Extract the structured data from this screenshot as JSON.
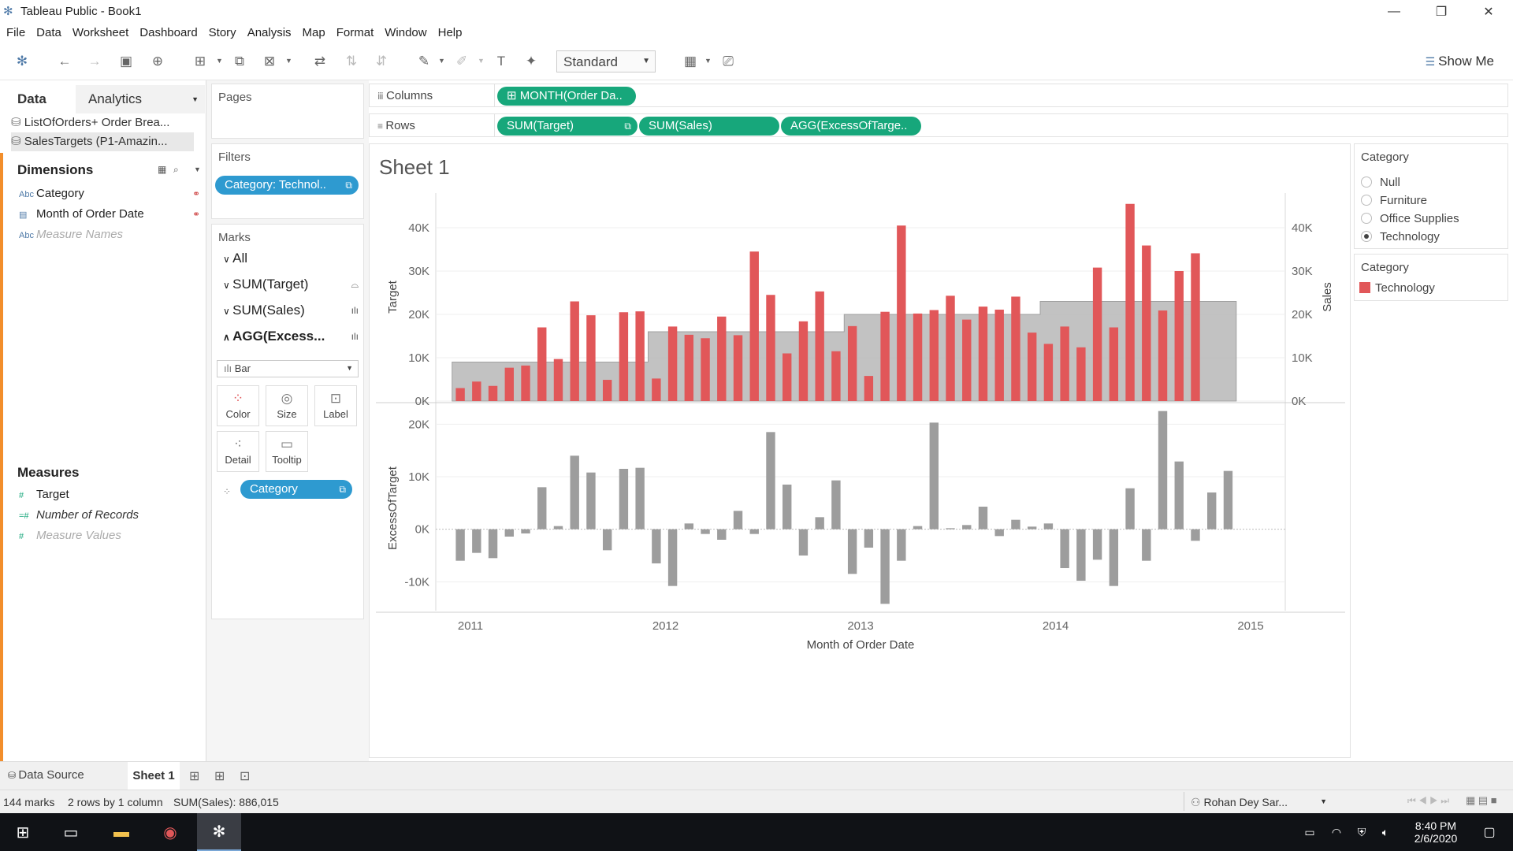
{
  "app": {
    "title": "Tableau Public - Book1"
  },
  "menu": [
    "File",
    "Data",
    "Worksheet",
    "Dashboard",
    "Story",
    "Analysis",
    "Map",
    "Format",
    "Window",
    "Help"
  ],
  "toolbar": {
    "fit_value": "Standard",
    "show_me_label": "Show Me"
  },
  "data_pane": {
    "tab_data": "Data",
    "tab_analytics": "Analytics",
    "sources": [
      "ListOfOrders+ Order Brea...",
      "SalesTargets (P1-Amazin..."
    ],
    "dimensions_title": "Dimensions",
    "dimensions": [
      {
        "type": "Abc",
        "label": "Category"
      },
      {
        "type": "date",
        "label": "Month of Order Date"
      },
      {
        "type": "Abc",
        "label": "Measure Names"
      }
    ],
    "measures_title": "Measures",
    "measures": [
      {
        "type": "#",
        "label": "Target"
      },
      {
        "type": "=#",
        "label": "Number of Records"
      },
      {
        "type": "#",
        "label": "Measure Values"
      }
    ]
  },
  "cards": {
    "pages_title": "Pages",
    "filters_title": "Filters",
    "filter_pill": "Category: Technol..",
    "marks_title": "Marks",
    "marks_rows": [
      "All",
      "SUM(Target)",
      "SUM(Sales)",
      "AGG(Excess..."
    ],
    "mark_type": "Bar",
    "mark_buttons": [
      "Color",
      "Size",
      "Label",
      "Detail",
      "Tooltip"
    ],
    "color_pill": "Category"
  },
  "shelves": {
    "columns_label": "Columns",
    "rows_label": "Rows",
    "columns_pills": [
      "MONTH(Order Da.."
    ],
    "rows_pills": [
      "SUM(Target)",
      "SUM(Sales)",
      "AGG(ExcessOfTarge.."
    ]
  },
  "sheet": {
    "title": "Sheet 1"
  },
  "legends": {
    "filter_title": "Category",
    "filter_options": [
      {
        "label": "Null",
        "selected": false
      },
      {
        "label": "Furniture",
        "selected": false
      },
      {
        "label": "Office Supplies",
        "selected": false
      },
      {
        "label": "Technology",
        "selected": true
      }
    ],
    "color_title": "Category",
    "color_items": [
      {
        "label": "Technology",
        "color": "#e15759"
      }
    ]
  },
  "chart_data": [
    {
      "type": "bar",
      "xlabel": "Month of Order Date",
      "ylabel": "Target",
      "ylabel_right": "Sales",
      "ylim": [
        0,
        48000
      ],
      "y_ticks": [
        "0K",
        "10K",
        "20K",
        "30K",
        "40K"
      ],
      "x_ticks": [
        "2011",
        "2012",
        "2013",
        "2014",
        "2015"
      ],
      "categories": [
        "2011-01",
        "2011-02",
        "2011-03",
        "2011-04",
        "2011-05",
        "2011-06",
        "2011-07",
        "2011-08",
        "2011-09",
        "2011-10",
        "2011-11",
        "2011-12",
        "2012-01",
        "2012-02",
        "2012-03",
        "2012-04",
        "2012-05",
        "2012-06",
        "2012-07",
        "2012-08",
        "2012-09",
        "2012-10",
        "2012-11",
        "2012-12",
        "2013-01",
        "2013-02",
        "2013-03",
        "2013-04",
        "2013-05",
        "2013-06",
        "2013-07",
        "2013-08",
        "2013-09",
        "2013-10",
        "2013-11",
        "2013-12",
        "2014-01",
        "2014-02",
        "2014-03",
        "2014-04",
        "2014-05",
        "2014-06",
        "2014-07",
        "2014-08",
        "2014-09",
        "2014-10",
        "2014-11",
        "2014-12"
      ],
      "series": [
        {
          "name": "SUM(Target)",
          "kind": "area",
          "color": "#b7b7b7",
          "values": [
            9000,
            9000,
            9000,
            9000,
            9000,
            9000,
            9000,
            9000,
            9000,
            9000,
            9000,
            9000,
            16000,
            16000,
            16000,
            16000,
            16000,
            16000,
            16000,
            16000,
            16000,
            16000,
            16000,
            16000,
            20000,
            20000,
            20000,
            20000,
            20000,
            20000,
            20000,
            20000,
            20000,
            20000,
            20000,
            20000,
            23000,
            23000,
            23000,
            23000,
            23000,
            23000,
            23000,
            23000,
            23000,
            23000,
            23000,
            23000
          ]
        },
        {
          "name": "SUM(Sales)",
          "kind": "bar",
          "color": "#e15759",
          "values": [
            3000,
            4500,
            3500,
            7700,
            8200,
            17000,
            9700,
            23000,
            19800,
            4900,
            20500,
            20700,
            5200,
            17200,
            15300,
            14500,
            19500,
            15200,
            34500,
            24500,
            11000,
            18400,
            25300,
            11500,
            17300,
            5800,
            20600,
            40500,
            20200,
            21000,
            24300,
            18800,
            21800,
            21100,
            24100,
            15800,
            13200,
            17200,
            12400,
            30800,
            17000,
            45500,
            35900,
            20900,
            30000,
            34100
          ]
        }
      ]
    },
    {
      "type": "bar",
      "xlabel": "Month of Order Date",
      "ylabel": "ExcessOfTarget",
      "ylim": [
        -15500,
        23500
      ],
      "y_ticks": [
        "-10K",
        "0K",
        "10K",
        "20K"
      ],
      "x_ticks": [
        "2011",
        "2012",
        "2013",
        "2014",
        "2015"
      ],
      "series": [
        {
          "name": "AGG(ExcessOfTarget)",
          "color": "#9d9d9d",
          "values": [
            -6000,
            -4500,
            -5500,
            -1400,
            -800,
            8000,
            600,
            14000,
            10800,
            -4000,
            11500,
            11700,
            -6500,
            -10800,
            1100,
            -900,
            -2000,
            3500,
            -900,
            18500,
            8500,
            -5000,
            2300,
            9300,
            -8500,
            -3500,
            -14200,
            -6000,
            600,
            20300,
            200,
            800,
            4300,
            -1300,
            1800,
            500,
            1100,
            -7400,
            -9800,
            -5800,
            -10800,
            7800,
            -6000,
            22500,
            12900,
            -2200,
            7000,
            11100
          ]
        }
      ]
    }
  ],
  "bottom": {
    "tabs": [
      "Data Source",
      "Sheet 1"
    ],
    "status": {
      "marks": "144 marks",
      "rows": "2 rows by 1 column",
      "sum": "SUM(Sales): 886,015",
      "user": "Rohan Dey Sar..."
    }
  },
  "taskbar": {
    "time": "8:40 PM",
    "date": "2/6/2020"
  }
}
